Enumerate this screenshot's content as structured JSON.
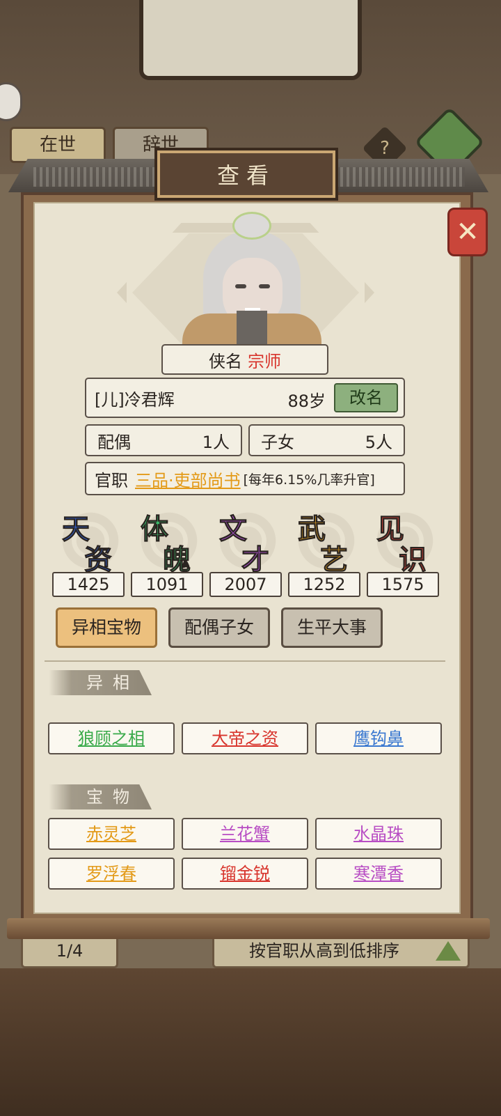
{
  "background": {
    "tab_alive": "在世",
    "tab_deceased": "辞世",
    "help_glyph": "?",
    "page_indicator": "1/4",
    "sort_label": "按官职从高到低排序"
  },
  "dialog": {
    "title": "查看",
    "close_glyph": "✕"
  },
  "profile": {
    "alias_label": "侠名",
    "alias_value": "宗师",
    "name": "[儿]冷君辉",
    "age": "88岁",
    "rename_label": "改名",
    "spouse_label": "配偶",
    "spouse_count": "1人",
    "children_label": "子女",
    "children_count": "5人",
    "office_label": "官职",
    "office_rank": "三品·吏部尚书",
    "office_rate": "[每年6.15%几率升官]"
  },
  "stats": [
    {
      "c1": "天",
      "c2": "资",
      "value": "1425",
      "color": "#2f5fd0"
    },
    {
      "c1": "体",
      "c2": "魄",
      "value": "1091",
      "color": "#3cb86a"
    },
    {
      "c1": "文",
      "c2": "才",
      "value": "2007",
      "color": "#a950c8"
    },
    {
      "c1": "武",
      "c2": "艺",
      "value": "1252",
      "color": "#e0a020"
    },
    {
      "c1": "见",
      "c2": "识",
      "value": "1575",
      "color": "#d8443a"
    }
  ],
  "tabs": [
    "异相宝物",
    "配偶子女",
    "生平大事"
  ],
  "traits_section": "异相",
  "traits": [
    {
      "label": "狼顾之相",
      "color": "#3aaa4a"
    },
    {
      "label": "大帝之资",
      "color": "#d8342c"
    },
    {
      "label": "鹰钩鼻",
      "color": "#3a78d0"
    }
  ],
  "treasures_section": "宝物",
  "treasures": [
    {
      "label": "赤灵芝",
      "color": "#e39a18"
    },
    {
      "label": "兰花蟹",
      "color": "#b84ec4"
    },
    {
      "label": "水晶珠",
      "color": "#b84ec4"
    },
    {
      "label": "罗浮春",
      "color": "#e39a18"
    },
    {
      "label": "镏金锐",
      "color": "#d8342c"
    },
    {
      "label": "寒潭香",
      "color": "#b84ec4"
    }
  ]
}
